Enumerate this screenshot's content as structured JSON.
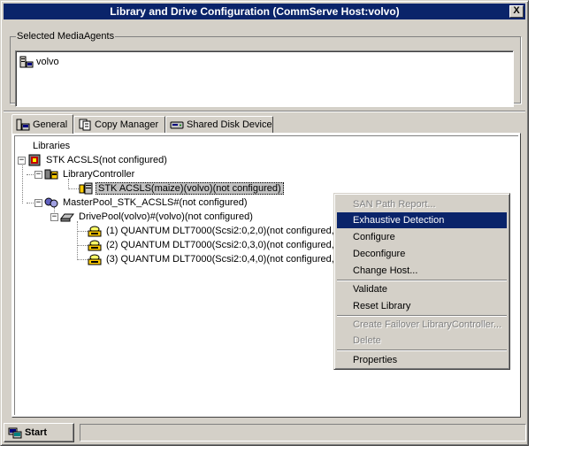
{
  "window": {
    "title": "Library and Drive Configuration (CommServe Host:volvo)",
    "close_label": "X"
  },
  "media_agents": {
    "legend": "Selected MediaAgents",
    "items": [
      {
        "label": "volvo",
        "icon": "server-icon"
      }
    ]
  },
  "tabs": [
    {
      "label": "General",
      "icon": "computer-icon",
      "active": true
    },
    {
      "label": "Copy Manager",
      "icon": "copy-icon",
      "active": false
    },
    {
      "label": "Shared Disk Device",
      "icon": "disk-icon",
      "active": false
    }
  ],
  "tree": {
    "root": "Libraries",
    "library": "STK ACSLS(not configured)",
    "controller_group": "LibraryController",
    "controller": "STK ACSLS(maize)(volvo)(not configured)",
    "masterpool": "MasterPool_STK_ACSLS#(not configured)",
    "drivepool": "DrivePool(volvo)#(volvo)(not configured)",
    "drives": [
      "(1) QUANTUM DLT7000(Scsi2:0,2,0)(not configured, di",
      "(2) QUANTUM DLT7000(Scsi2:0,3,0)(not configured, di",
      "(3) QUANTUM DLT7000(Scsi2:0,4,0)(not configured, di"
    ]
  },
  "context_menu": {
    "items": [
      {
        "label": "SAN Path Report...",
        "disabled": true
      },
      {
        "label": "Exhaustive Detection",
        "highlighted": true
      },
      {
        "label": "Configure"
      },
      {
        "label": "Deconfigure"
      },
      {
        "label": "Change Host..."
      },
      {
        "label": "Validate"
      },
      {
        "label": "Reset Library"
      },
      {
        "label": "Create Failover LibraryController...",
        "disabled": true
      },
      {
        "label": "Delete",
        "disabled": true
      },
      {
        "label": "Properties"
      }
    ]
  },
  "footer": {
    "start_label": "Start",
    "status_text": ""
  },
  "colors": {
    "titlebar": "#0a246a",
    "face": "#d4d0c8",
    "highlight": "#0a246a"
  }
}
